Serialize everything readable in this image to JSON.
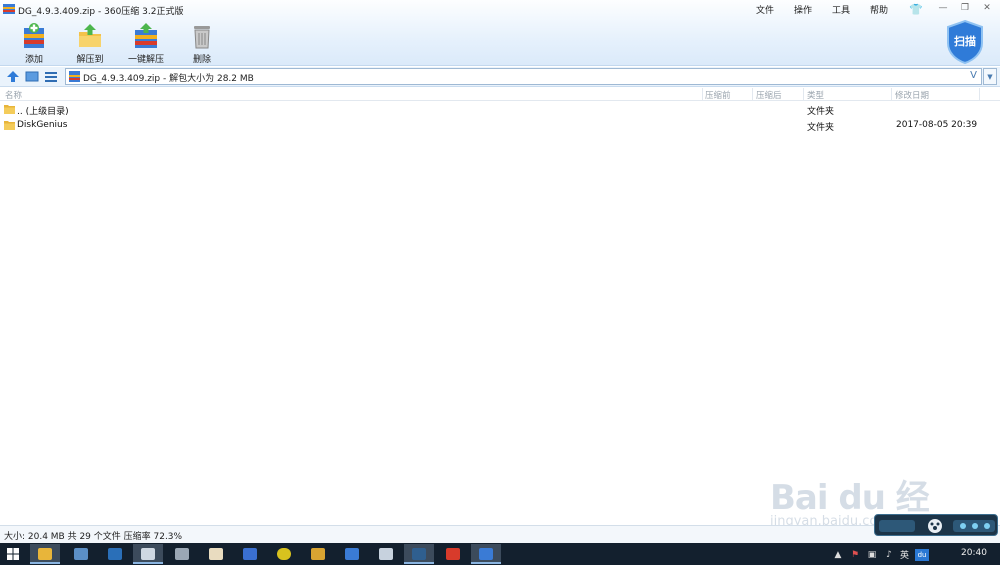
{
  "window": {
    "title": "DG_4.9.3.409.zip - 360压缩 3.2正式版"
  },
  "menu": {
    "items": [
      "文件",
      "操作",
      "工具",
      "帮助"
    ]
  },
  "toolbar": {
    "items": [
      {
        "label": "添加",
        "icon": "add-archive-icon"
      },
      {
        "label": "解压到",
        "icon": "extract-to-icon"
      },
      {
        "label": "一键解压",
        "icon": "one-click-extract-icon"
      },
      {
        "label": "删除",
        "icon": "delete-icon"
      }
    ],
    "scan_label": "扫描"
  },
  "address": {
    "text": "DG_4.9.3.409.zip - 解包大小为 28.2 MB",
    "v_glyph": "V",
    "dropdown_glyph": "▼"
  },
  "columns": {
    "name": "名称",
    "compressed_before": "压缩前",
    "compressed_after": "压缩后",
    "type": "类型",
    "modified": "修改日期"
  },
  "files": [
    {
      "name": ".. (上级目录)",
      "type": "文件夹",
      "date": ""
    },
    {
      "name": "DiskGenius",
      "type": "文件夹",
      "date": "2017-08-05 20:39"
    }
  ],
  "status": {
    "text": "大小: 20.4 MB 共 29 个文件 压缩率 72.3%"
  },
  "watermark": {
    "brand": "Bai du 经验",
    "sub": "jingyan.baidu.com"
  },
  "taskbar": {
    "ime": "英",
    "du": "du",
    "clock": "20:40"
  },
  "colors": {
    "accent": "#2f7bd8",
    "taskbar_bg": "#13202e",
    "toolbar_bg": "#e6f1fc"
  }
}
